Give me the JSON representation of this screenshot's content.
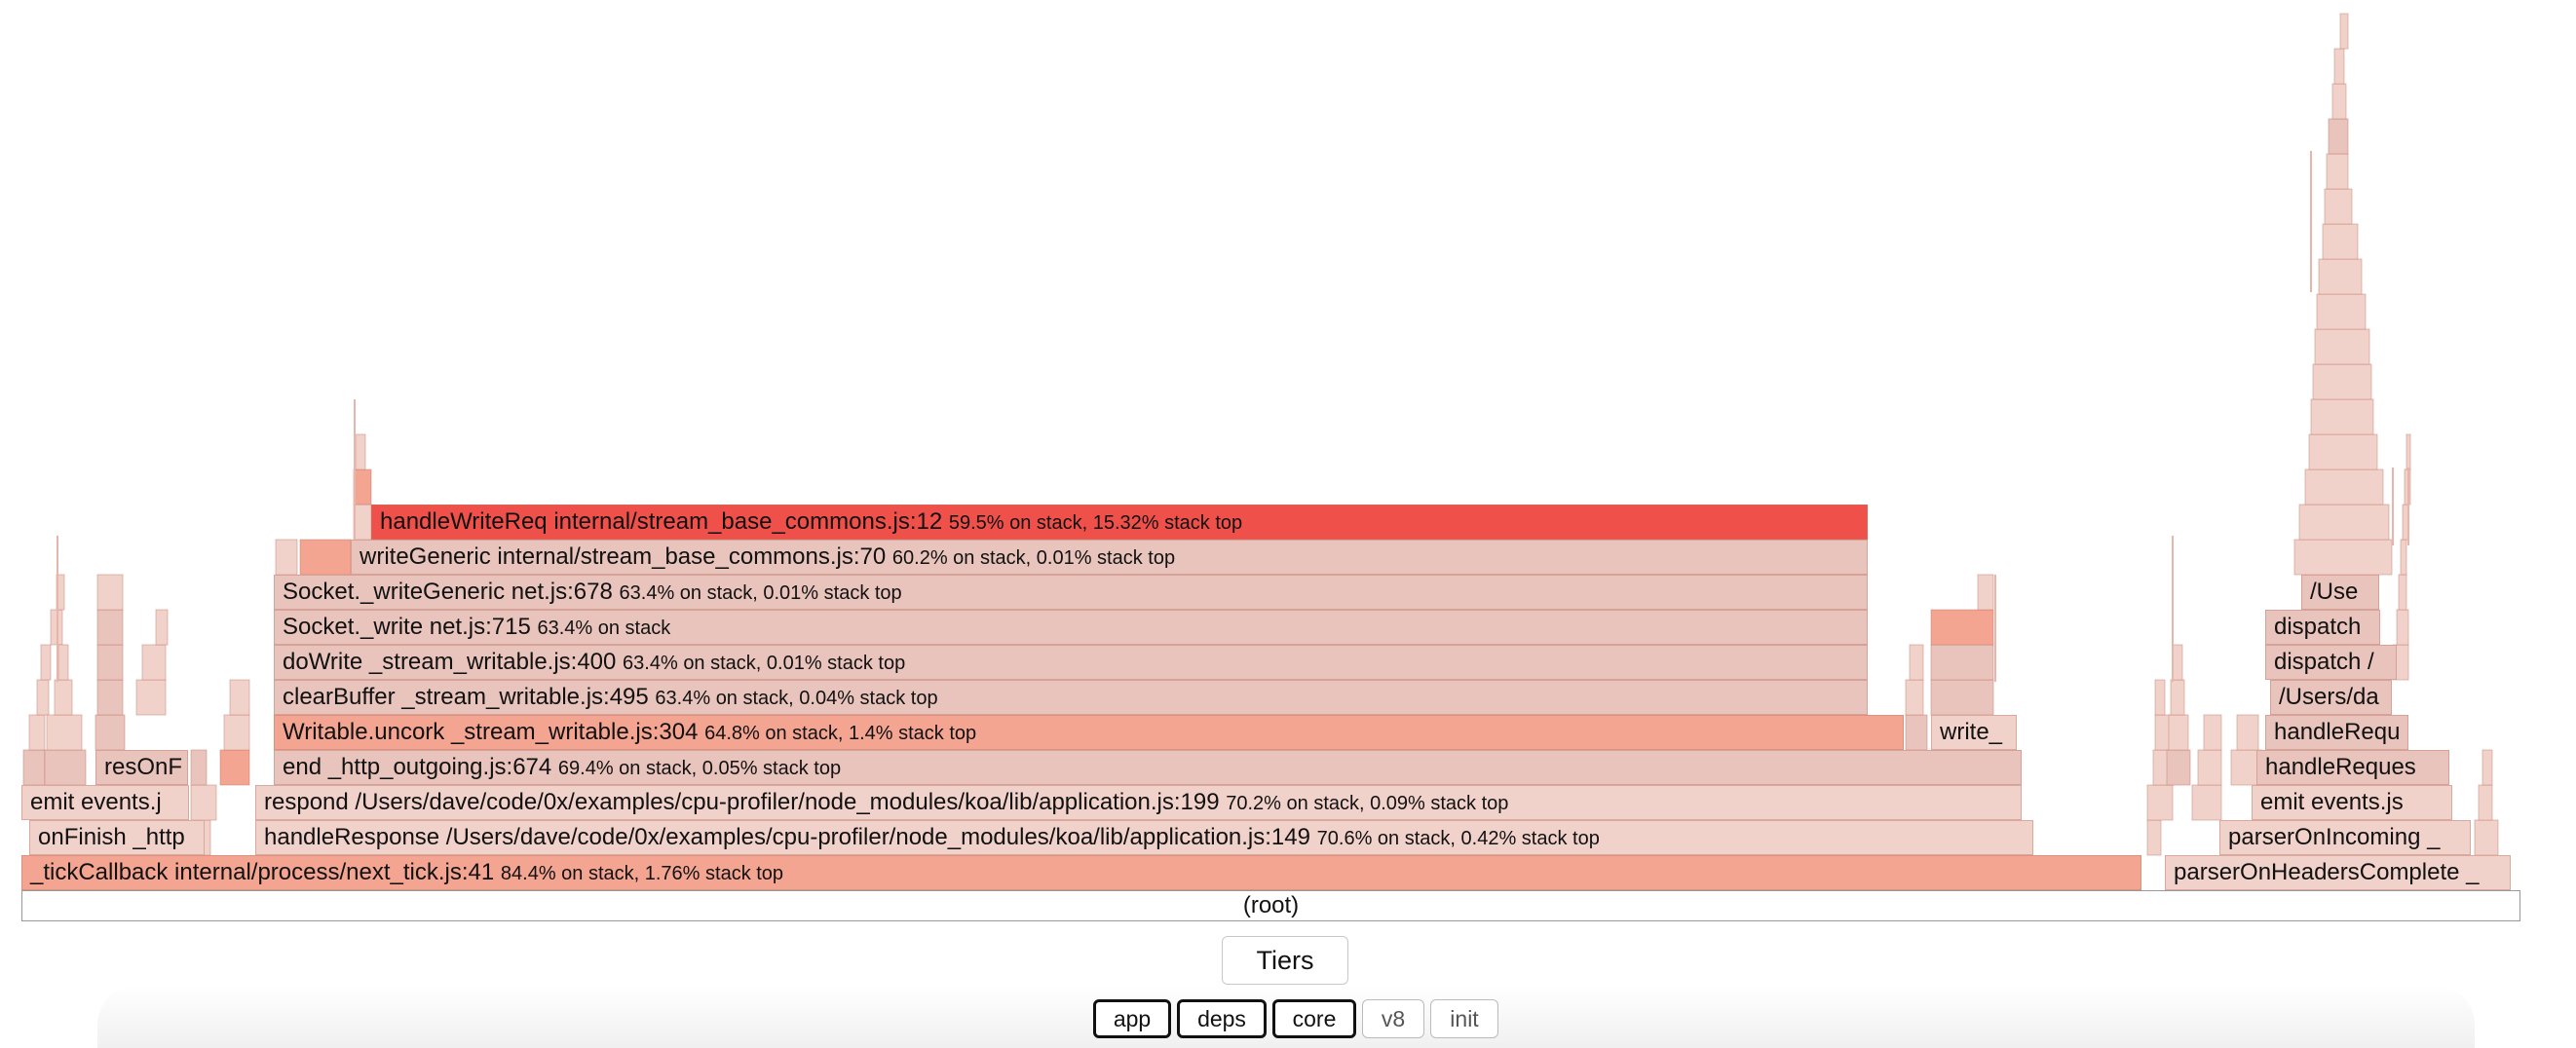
{
  "root_label": "(root)",
  "tiers_label": "Tiers",
  "tiers": [
    {
      "label": "app",
      "active": true
    },
    {
      "label": "deps",
      "active": true
    },
    {
      "label": "core",
      "active": true
    },
    {
      "label": "v8",
      "active": false
    },
    {
      "label": "init",
      "active": false
    }
  ],
  "colors": {
    "hot": "#f0504a",
    "warm": "#f4a592",
    "base": "#e9c4bc",
    "light": "#f1d2cb"
  },
  "frames": [
    {
      "name": "_tickCallback internal/process/next_tick.js:41",
      "meta": "84.4% on stack, 1.76% stack top"
    },
    {
      "name": "handleResponse /Users/dave/code/0x/examples/cpu-profiler/node_modules/koa/lib/application.js:149",
      "meta": "70.6% on stack, 0.42% stack top"
    },
    {
      "name": "respond /Users/dave/code/0x/examples/cpu-profiler/node_modules/koa/lib/application.js:199",
      "meta": "70.2% on stack, 0.09% stack top"
    },
    {
      "name": "end _http_outgoing.js:674",
      "meta": "69.4% on stack, 0.05% stack top"
    },
    {
      "name": "Writable.uncork _stream_writable.js:304",
      "meta": "64.8% on stack, 1.4% stack top"
    },
    {
      "name": "clearBuffer _stream_writable.js:495",
      "meta": "63.4% on stack, 0.04% stack top"
    },
    {
      "name": "doWrite _stream_writable.js:400",
      "meta": "63.4% on stack, 0.01% stack top"
    },
    {
      "name": "Socket._write net.js:715",
      "meta": "63.4% on stack"
    },
    {
      "name": "Socket._writeGeneric net.js:678",
      "meta": "63.4% on stack, 0.01% stack top"
    },
    {
      "name": "writeGeneric internal/stream_base_commons.js:70",
      "meta": "60.2% on stack, 0.01% stack top"
    },
    {
      "name": "handleWriteReq internal/stream_base_commons.js:12",
      "meta": "59.5% on stack, 15.32% stack top"
    },
    {
      "name": "onFinish _http",
      "meta": ""
    },
    {
      "name": "emit events.j",
      "meta": ""
    },
    {
      "name": "resOnF",
      "meta": ""
    },
    {
      "name": "write_",
      "meta": ""
    },
    {
      "name": "parserOnHeadersComplete _",
      "meta": ""
    },
    {
      "name": "parserOnIncoming _",
      "meta": ""
    },
    {
      "name": "emit events.js",
      "meta": ""
    },
    {
      "name": "handleReques",
      "meta": ""
    },
    {
      "name": "handleRequ",
      "meta": ""
    },
    {
      "name": "/Users/da",
      "meta": ""
    },
    {
      "name": "dispatch /",
      "meta": ""
    },
    {
      "name": "dispatch",
      "meta": ""
    },
    {
      "name": "/Use",
      "meta": ""
    }
  ]
}
